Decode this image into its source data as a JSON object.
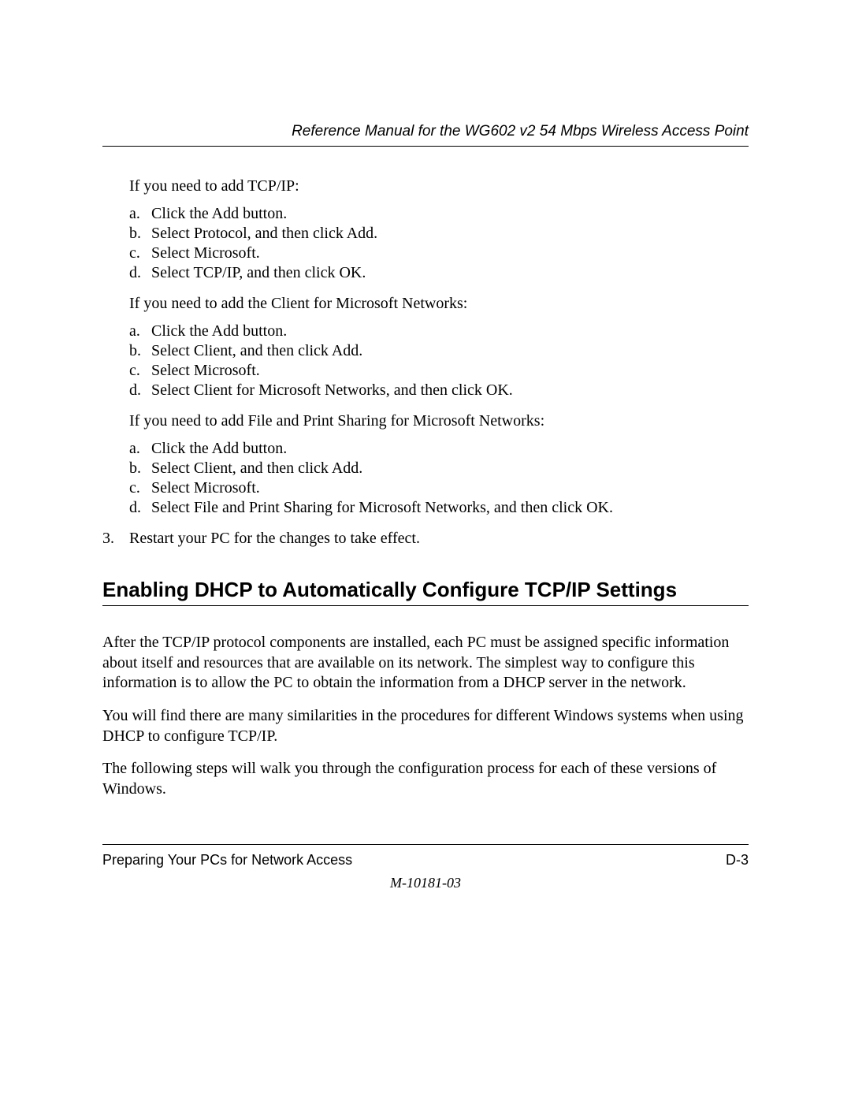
{
  "header": {
    "title": "Reference Manual for the WG602 v2 54 Mbps Wireless Access Point"
  },
  "content": {
    "tcpip_intro": "If you need to add TCP/IP:",
    "tcpip_steps": [
      "Click the Add button.",
      "Select Protocol, and then click Add.",
      "Select Microsoft.",
      "Select TCP/IP, and then click OK."
    ],
    "client_intro": "If you need to add the Client for Microsoft Networks:",
    "client_steps": [
      "Click the Add button.",
      "Select Client, and then click Add.",
      "Select Microsoft.",
      "Select Client for Microsoft Networks, and then click OK."
    ],
    "fps_intro": "If you need to add File and Print Sharing for Microsoft Networks:",
    "fps_steps": [
      "Click the Add button.",
      "Select Client, and then click Add.",
      "Select Microsoft.",
      "Select File and Print Sharing for Microsoft Networks, and then click OK."
    ],
    "step3_marker": "3.",
    "step3_text": "Restart your PC for the changes to take effect.",
    "heading": "Enabling DHCP to Automatically Configure TCP/IP Settings",
    "para1": "After the TCP/IP protocol components are installed, each PC must be assigned specific information about itself and resources that are available on its network. The simplest way to configure this information is to allow the PC to obtain the information from a DHCP server in the network.",
    "para2": "You will find there are many similarities in the procedures for different Windows systems when using DHCP to configure TCP/IP.",
    "para3": "The following steps will walk you through the configuration process for each of these versions of Windows."
  },
  "markers": [
    "a.",
    "b.",
    "c.",
    "d."
  ],
  "footer": {
    "section": "Preparing Your PCs for Network Access",
    "page": "D-3",
    "docnum": "M-10181-03"
  }
}
